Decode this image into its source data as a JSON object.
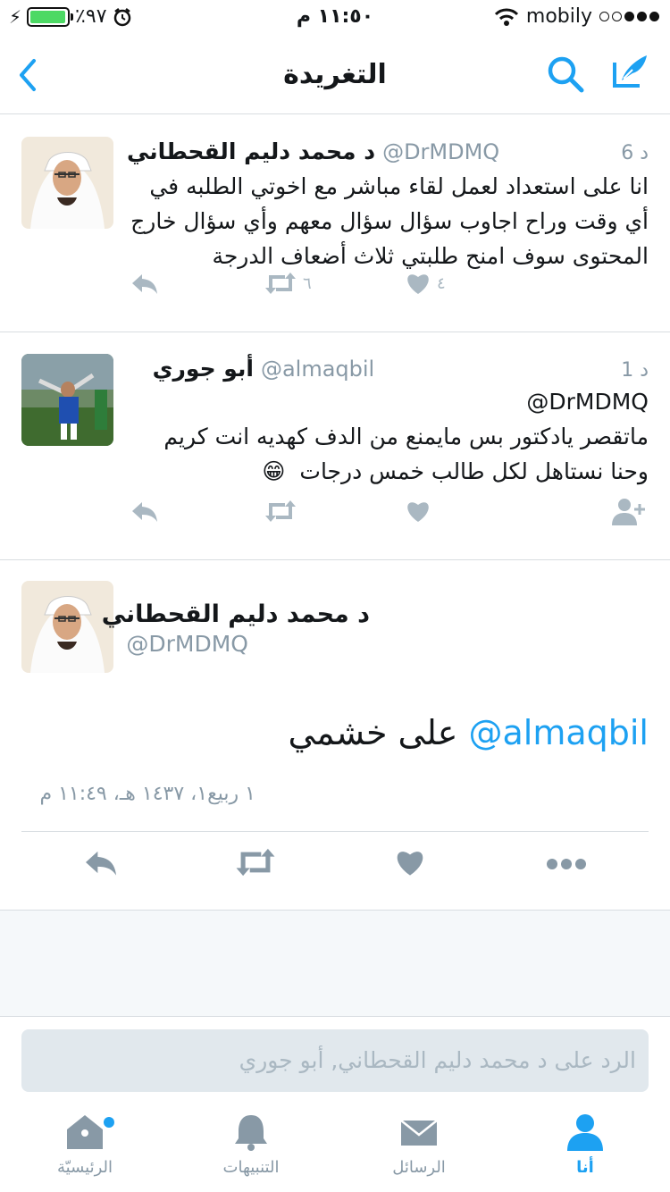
{
  "status_bar": {
    "battery_percent": "٪٩٧",
    "battery_level": 0.97,
    "time": "١١:٥٠ م",
    "carrier": "mobily"
  },
  "nav": {
    "title": "التغريدة",
    "back_icon": "chevron-left-icon",
    "search_icon": "search-icon",
    "compose_icon": "compose-tweet-icon",
    "accent_color": "#1da1f2"
  },
  "tweets": [
    {
      "name": "د محمد دليم القحطاني",
      "handle": "@DrMDMQ",
      "time": "6 د",
      "lines": [
        "انا على استعداد لعمل لقاء مباشر مع اخوتي الطلبه في",
        "أي  وقت وراح اجاوب سؤال سؤال معهم وأي سؤال خارج",
        "المحتوى سوف امنح طلبتي ثلاث أضعاف الدرجة"
      ],
      "retweet_count": "٦",
      "like_count": "٤"
    },
    {
      "name": "أبو جوري",
      "handle": "@almaqbil",
      "time": "1 د",
      "lines": [
        "@DrMDMQ",
        "ماتقصر يادكتور بس مايمنع من الدف كهديه انت كريم",
        "وحنا نستاهل لكل طالب خمس درجات"
      ],
      "emoji": "😁"
    }
  ],
  "detail": {
    "name": "د محمد دليم القحطاني",
    "handle": "@DrMDMQ",
    "mention": "@almaqbil",
    "text": "على خشمي",
    "date": "١ ربيع١، ١٤٣٧ هـ، ١١:٤٩ م"
  },
  "reply": {
    "placeholder": "الرد على د محمد دليم القحطاني, أبو جوري"
  },
  "tabs": [
    {
      "label": "الرئيسيّة",
      "icon": "home-icon",
      "active": false
    },
    {
      "label": "التنبيهات",
      "icon": "bell-icon",
      "active": false
    },
    {
      "label": "الرسائل",
      "icon": "envelope-icon",
      "active": false
    },
    {
      "label": "أنا",
      "icon": "person-icon",
      "active": true
    }
  ]
}
